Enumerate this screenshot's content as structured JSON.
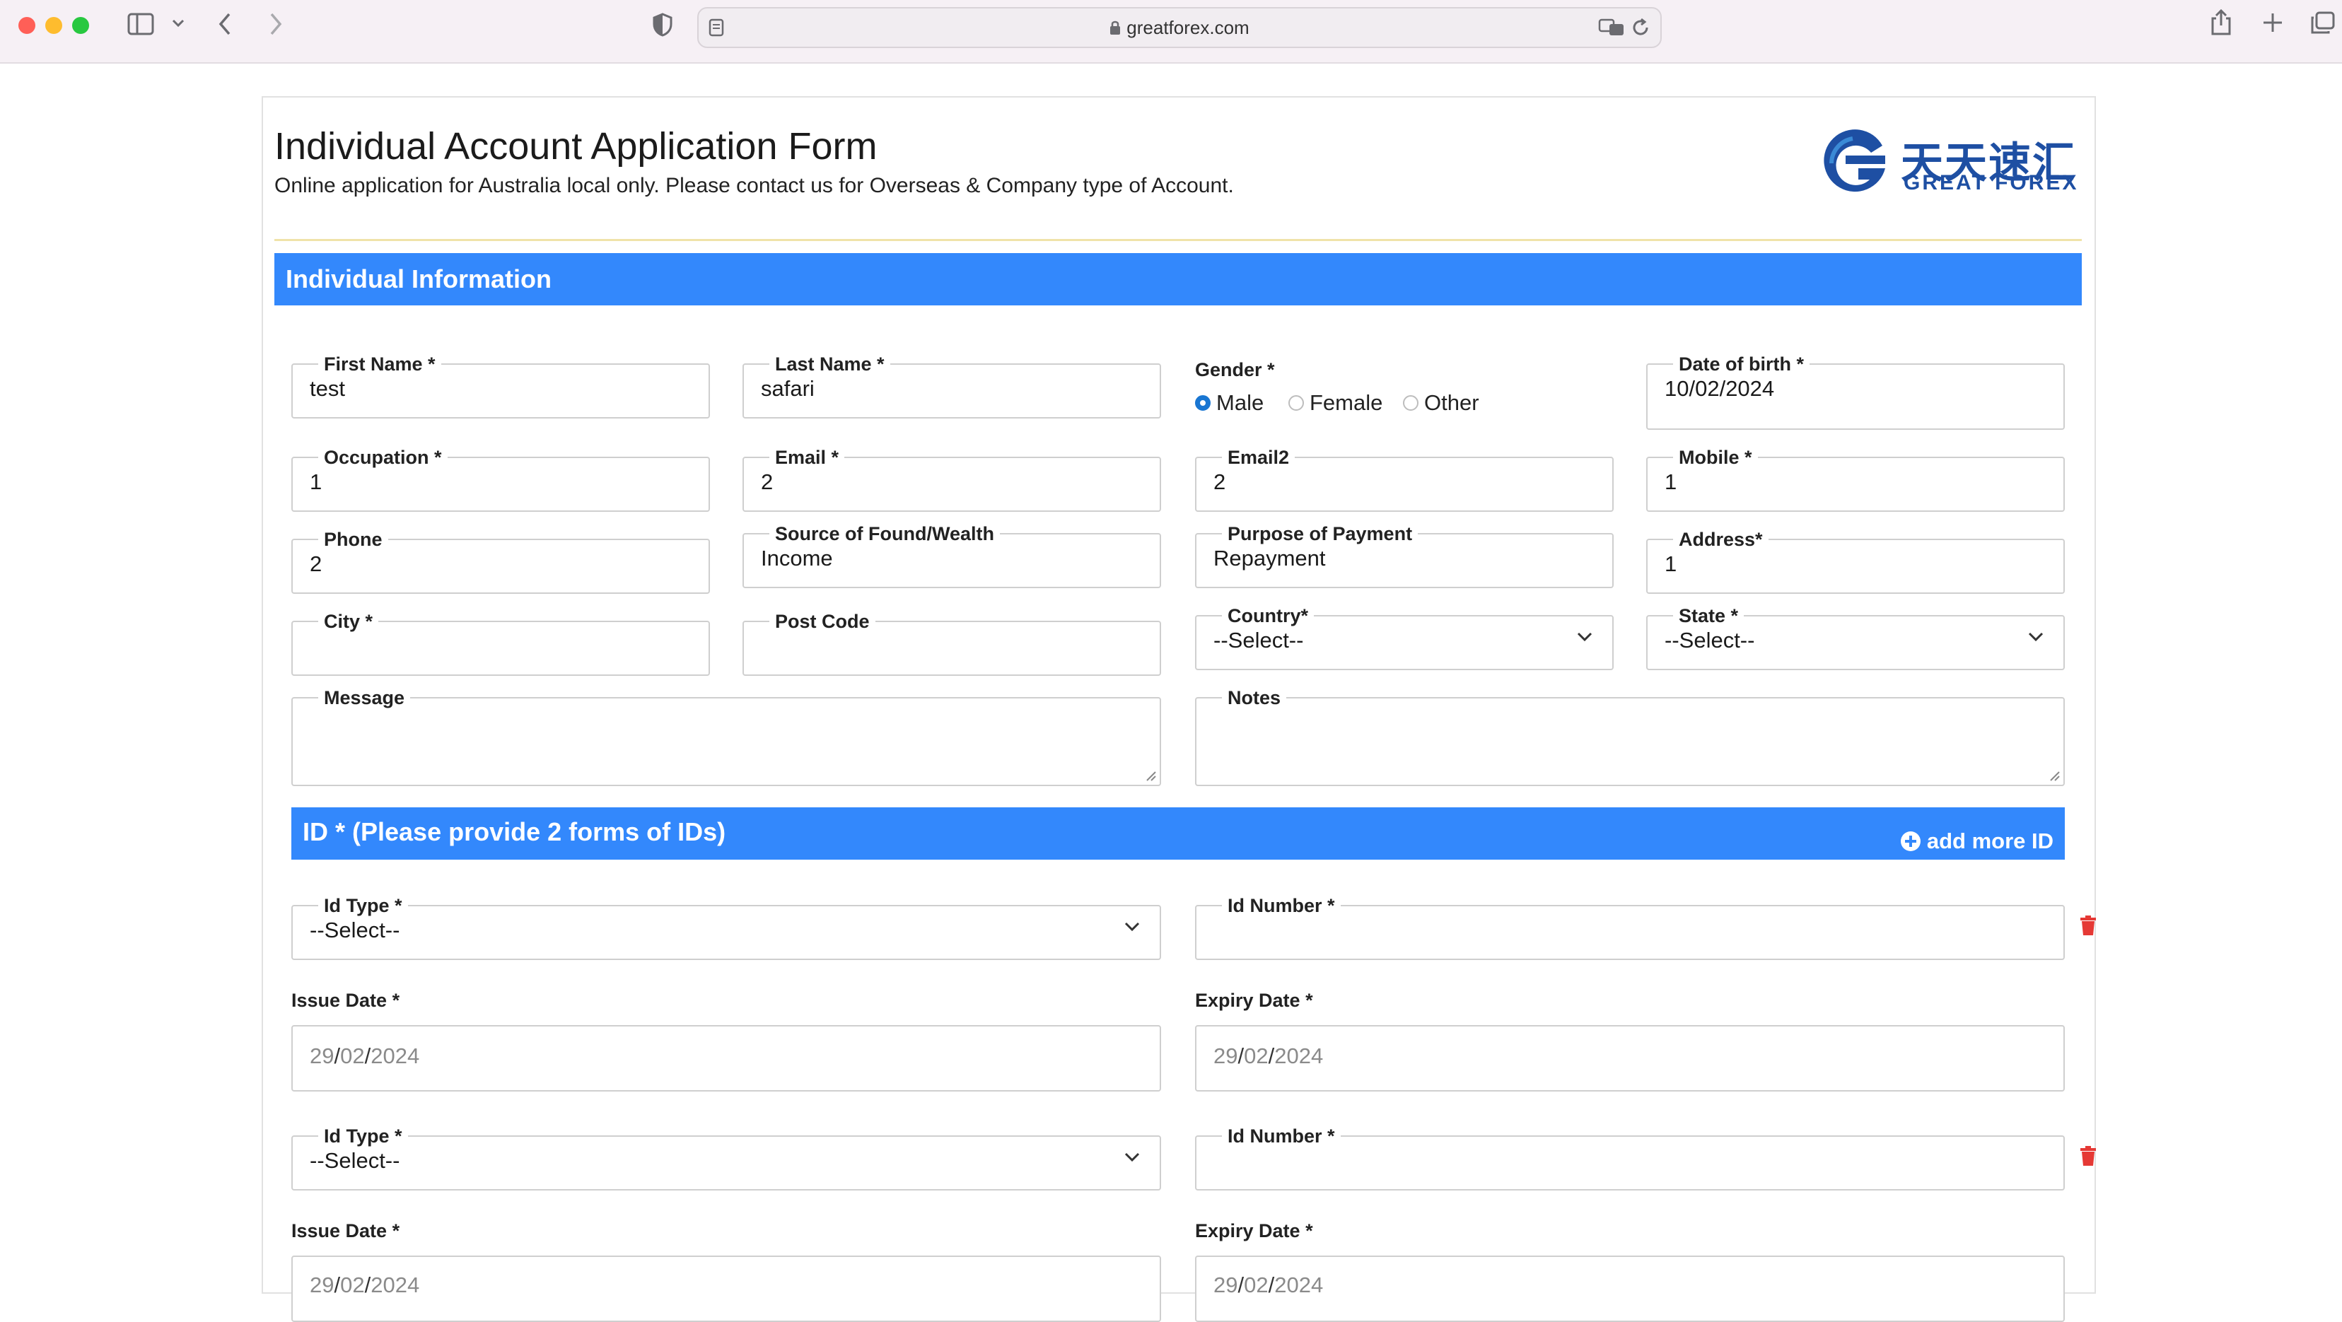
{
  "browser": {
    "url": "greatforex.com"
  },
  "form": {
    "title": "Individual Account Application Form",
    "subtitle": "Online application for Australia local only. Please contact us for Overseas & Company type of Account.",
    "logo": {
      "cn": "天天速汇",
      "en": "GREAT FOREX"
    }
  },
  "individual": {
    "heading": "Individual Information",
    "first_name": {
      "label": "First Name *",
      "value": "test"
    },
    "last_name": {
      "label": "Last Name *",
      "value": "safari"
    },
    "gender": {
      "label": "Gender *",
      "options": [
        "Male",
        "Female",
        "Other"
      ],
      "selected": "Male"
    },
    "dob": {
      "label": "Date of birth *",
      "value": "10/02/2024"
    },
    "occupation": {
      "label": "Occupation *",
      "value": "1"
    },
    "email": {
      "label": "Email *",
      "value": "2"
    },
    "email2": {
      "label": "Email2",
      "value": "2"
    },
    "mobile": {
      "label": "Mobile *",
      "value": "1"
    },
    "phone": {
      "label": "Phone",
      "value": "2"
    },
    "source": {
      "label": "Source of Found/Wealth",
      "value": "Income"
    },
    "purpose": {
      "label": "Purpose of Payment",
      "value": "Repayment"
    },
    "address": {
      "label": "Address*",
      "value": "1"
    },
    "city": {
      "label": "City *",
      "value": ""
    },
    "postcode": {
      "label": "Post Code",
      "value": ""
    },
    "country": {
      "label": "Country*",
      "value": "--Select--"
    },
    "state": {
      "label": "State *",
      "value": "--Select--"
    },
    "message": {
      "label": "Message",
      "value": ""
    },
    "notes": {
      "label": "Notes",
      "value": ""
    }
  },
  "ids": {
    "heading": "ID * (Please provide 2 forms of IDs)",
    "add_label": "add more ID",
    "id_type_label": "Id Type *",
    "id_number_label": "Id Number *",
    "issue_label": "Issue Date *",
    "expiry_label": "Expiry Date *",
    "select_placeholder": "--Select--",
    "date_placeholder": {
      "dd": "29",
      "mm": "02",
      "yyyy": "2024"
    }
  },
  "colors": {
    "band": "#3388fc",
    "radio_on": "#1976d2",
    "trash": "#e53935",
    "divider": "#f0e3a9"
  }
}
